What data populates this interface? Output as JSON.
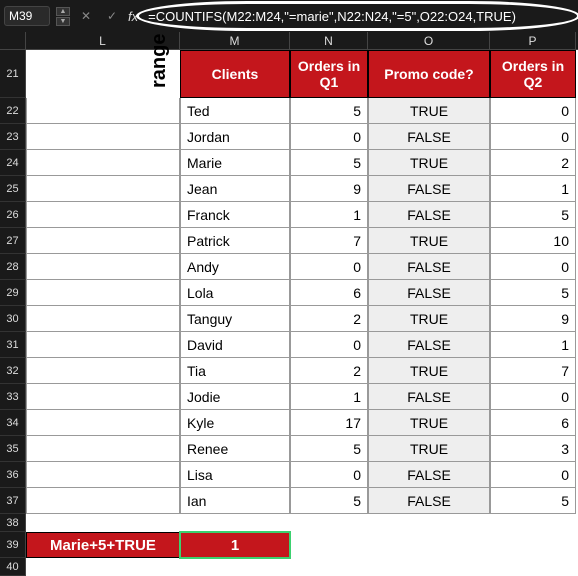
{
  "cell_ref": "M39",
  "fx_label": "fx",
  "formula": "=COUNTIFS(M22:M24,\"=marie\",N22:N24,\"=5\",O22:O24,TRUE)",
  "col_headers": {
    "L": "L",
    "M": "M",
    "N": "N",
    "O": "O",
    "P": "P"
  },
  "row_nums": [
    "21",
    "22",
    "23",
    "24",
    "25",
    "26",
    "27",
    "28",
    "29",
    "30",
    "31",
    "32",
    "33",
    "34",
    "35",
    "36",
    "37",
    "38",
    "39",
    "40"
  ],
  "range_label": "range",
  "table": {
    "headers": {
      "clients": "Clients",
      "q1": "Orders in Q1",
      "promo": "Promo code?",
      "q2": "Orders in Q2"
    },
    "rows": [
      {
        "client": "Ted",
        "q1": 5,
        "promo": "TRUE",
        "q2": 0
      },
      {
        "client": "Jordan",
        "q1": 0,
        "promo": "FALSE",
        "q2": 0
      },
      {
        "client": "Marie",
        "q1": 5,
        "promo": "TRUE",
        "q2": 2
      },
      {
        "client": "Jean",
        "q1": 9,
        "promo": "FALSE",
        "q2": 1
      },
      {
        "client": "Franck",
        "q1": 1,
        "promo": "FALSE",
        "q2": 5
      },
      {
        "client": "Patrick",
        "q1": 7,
        "promo": "TRUE",
        "q2": 10
      },
      {
        "client": "Andy",
        "q1": 0,
        "promo": "FALSE",
        "q2": 0
      },
      {
        "client": "Lola",
        "q1": 6,
        "promo": "FALSE",
        "q2": 5
      },
      {
        "client": "Tanguy",
        "q1": 2,
        "promo": "TRUE",
        "q2": 9
      },
      {
        "client": "David",
        "q1": 0,
        "promo": "FALSE",
        "q2": 1
      },
      {
        "client": "Tia",
        "q1": 2,
        "promo": "TRUE",
        "q2": 7
      },
      {
        "client": "Jodie",
        "q1": 1,
        "promo": "FALSE",
        "q2": 0
      },
      {
        "client": "Kyle",
        "q1": 17,
        "promo": "TRUE",
        "q2": 6
      },
      {
        "client": "Renee",
        "q1": 5,
        "promo": "TRUE",
        "q2": 3
      },
      {
        "client": "Lisa",
        "q1": 0,
        "promo": "FALSE",
        "q2": 0
      },
      {
        "client": "Ian",
        "q1": 5,
        "promo": "FALSE",
        "q2": 5
      }
    ]
  },
  "result": {
    "label": "Marie+5+TRUE",
    "value": "1"
  },
  "icons": {
    "cancel": "✕",
    "confirm": "✓",
    "up": "▲",
    "down": "▼"
  }
}
